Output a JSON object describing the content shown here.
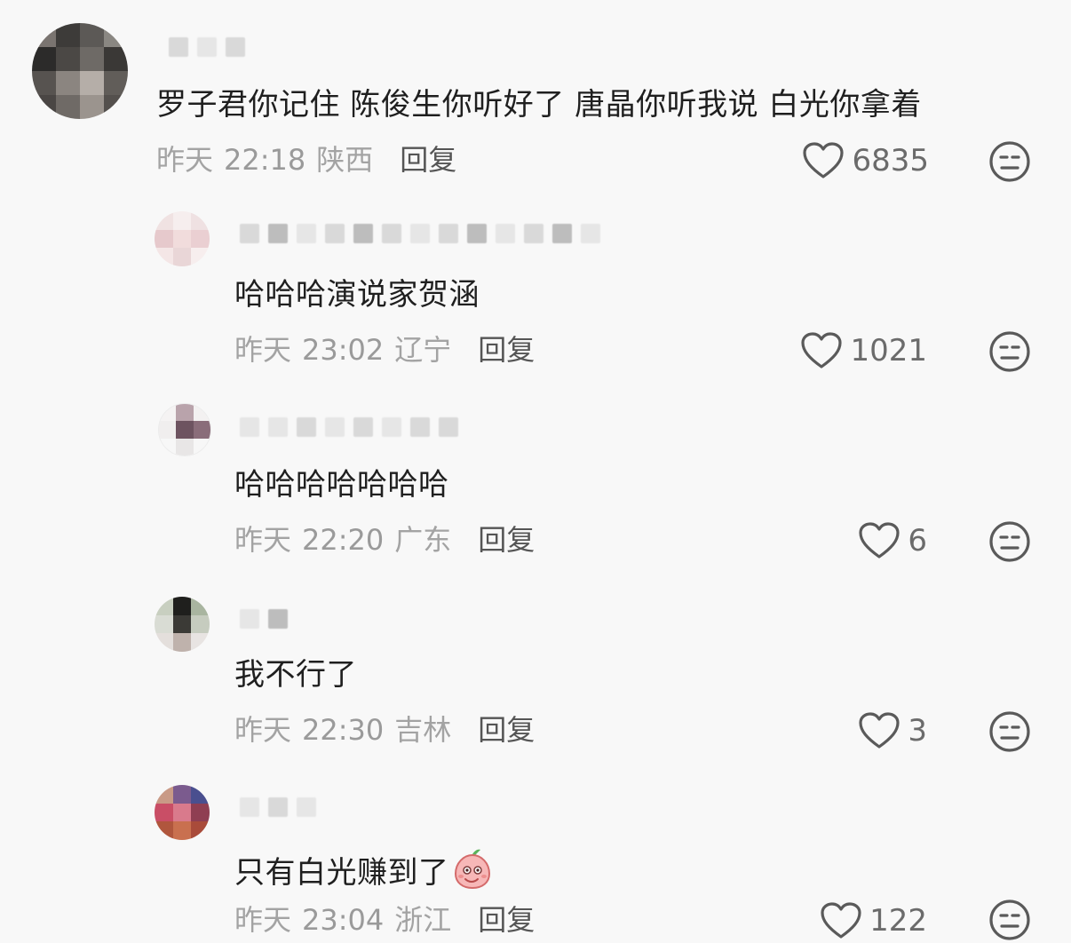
{
  "comments": [
    {
      "text": "罗子君你记住 陈俊生你听好了 唐晶你听我说 白光你拿着",
      "date": "昨天",
      "time": "22:18",
      "location": "陕西",
      "reply_label": "回复",
      "likes": "6835"
    },
    {
      "text": "哈哈哈演说家贺涵",
      "date": "昨天",
      "time": "23:02",
      "location": "辽宁",
      "reply_label": "回复",
      "likes": "1021"
    },
    {
      "text": "哈哈哈哈哈哈哈",
      "date": "昨天",
      "time": "22:20",
      "location": "广东",
      "reply_label": "回复",
      "likes": "6"
    },
    {
      "text": "我不行了",
      "date": "昨天",
      "time": "22:30",
      "location": "吉林",
      "reply_label": "回复",
      "likes": "3"
    },
    {
      "text": "只有白光赚到了",
      "date": "昨天",
      "time": "23:04",
      "location": "浙江",
      "reply_label": "回复",
      "likes": "122"
    }
  ],
  "icons": {
    "like": "heart-outline-icon",
    "dislike": "meh-face-icon",
    "inline_emoji": "peach-emoji-icon"
  },
  "colors": {
    "background": "#f8f8f8",
    "text": "#1f1f1f",
    "meta": "#9a9a9a",
    "icon": "#555555"
  }
}
